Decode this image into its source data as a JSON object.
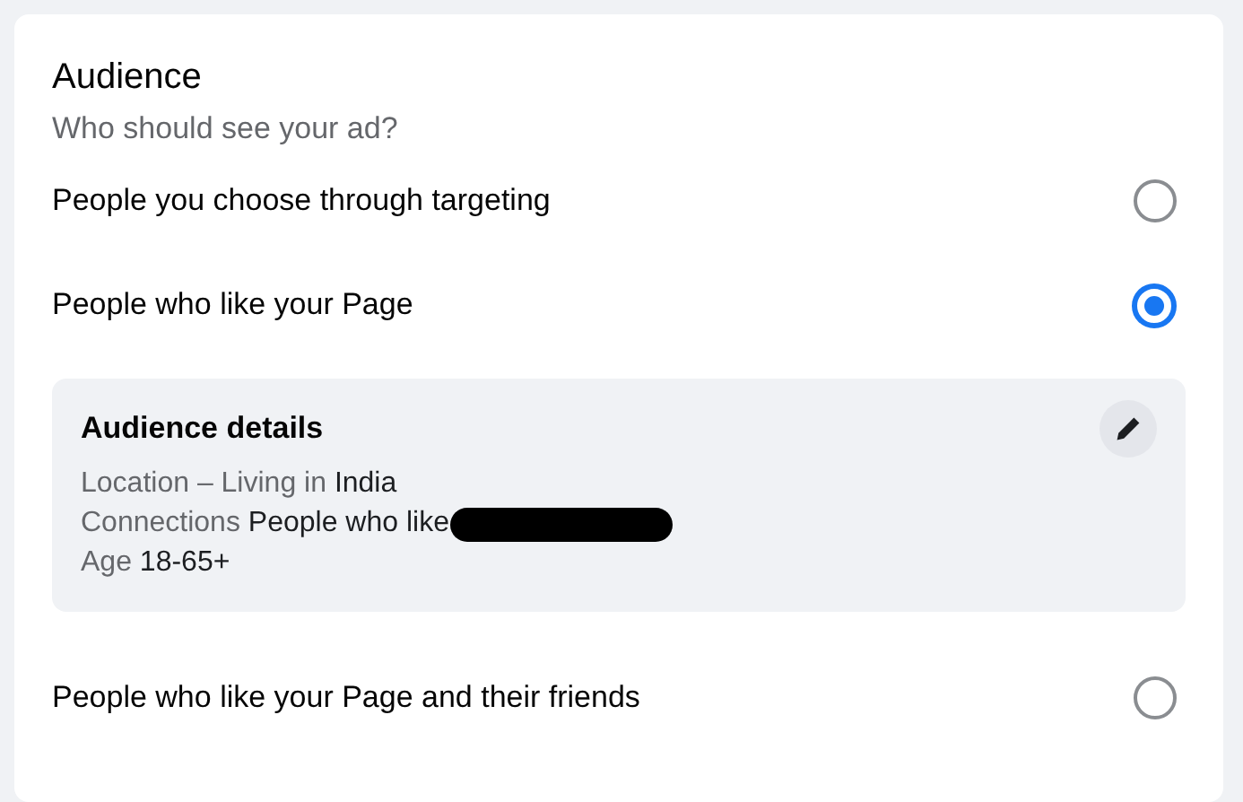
{
  "card": {
    "title": "Audience",
    "subtitle": "Who should see your ad?"
  },
  "options": [
    {
      "label": "People you choose through targeting",
      "selected": false
    },
    {
      "label": "People who like your Page",
      "selected": true,
      "details": {
        "title": "Audience details",
        "lines": [
          {
            "label": "Location – Living in",
            "value": "India",
            "redacted": false
          },
          {
            "label": "Connections",
            "value": "People who like",
            "redacted": true
          },
          {
            "label": "Age",
            "value": "18-65+",
            "redacted": false
          }
        ]
      }
    },
    {
      "label": "People who like your Page and their friends",
      "selected": false
    }
  ]
}
